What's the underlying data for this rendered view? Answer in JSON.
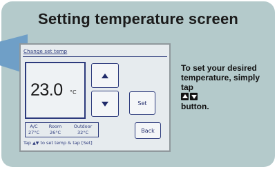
{
  "title": "Setting temperature screen",
  "screen": {
    "header": "Change set temp",
    "temperature": "23.0",
    "unit": "°C",
    "buttons": {
      "up": "▲",
      "down": "▼",
      "set": "Set",
      "back": "Back"
    },
    "status": {
      "ac_label": "A/C",
      "ac_value": "27°C",
      "room_label": "Room",
      "room_value": "26°C",
      "outdoor_label": "Outdoor",
      "outdoor_value": "32°C"
    },
    "hint_prefix": "Tap",
    "hint_arrows": "▲▼",
    "hint_suffix": "to set temp & tap [Set]"
  },
  "explanation": {
    "line1": "To set your desired temperature, simply tap",
    "line2": "button."
  },
  "colors": {
    "frame": "#b4cacb",
    "pointer": "#6f9fc7",
    "screen_bg": "#e6ebee",
    "screen_ink": "#2c3a7c"
  }
}
